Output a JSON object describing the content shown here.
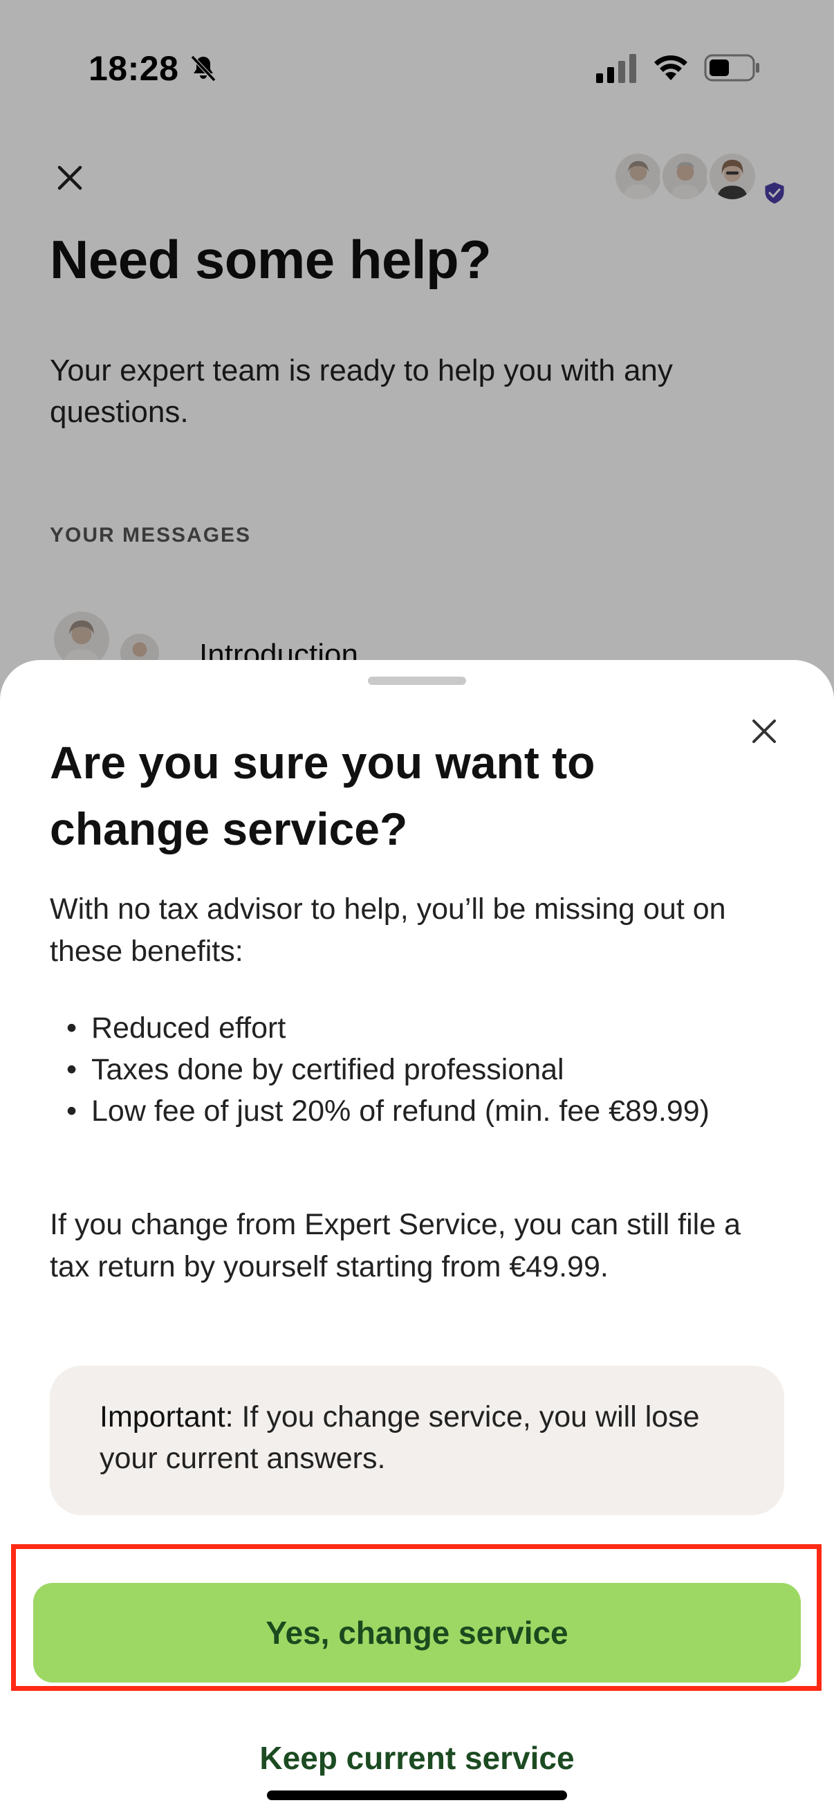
{
  "status_bar": {
    "time": "18:28"
  },
  "background": {
    "title": "Need some help?",
    "subtitle": "Your expert team is ready to help you with any questions.",
    "section_label": "YOUR MESSAGES",
    "message_title": "Introduction"
  },
  "sheet": {
    "title": "Are you sure you want to change service?",
    "intro": "With no tax advisor to help, you’ll be missing out on these benefits:",
    "benefits": [
      "Reduced effort",
      "Taxes done by certified professional",
      "Low fee of just 20% of refund (min. fee €89.99)"
    ],
    "change_note": "If you change from Expert Service, you can still file a tax return by yourself starting from €49.99.",
    "important_label": "Important:",
    "important_text": " If you change service, you will lose your current answers.",
    "primary_button": "Yes, change service",
    "secondary_button": "Keep current service"
  },
  "colors": {
    "primary_button_bg": "#9dd864",
    "primary_button_text": "#1a4a1e",
    "highlight_border": "#ff2a14",
    "important_bg": "#f2efec"
  }
}
